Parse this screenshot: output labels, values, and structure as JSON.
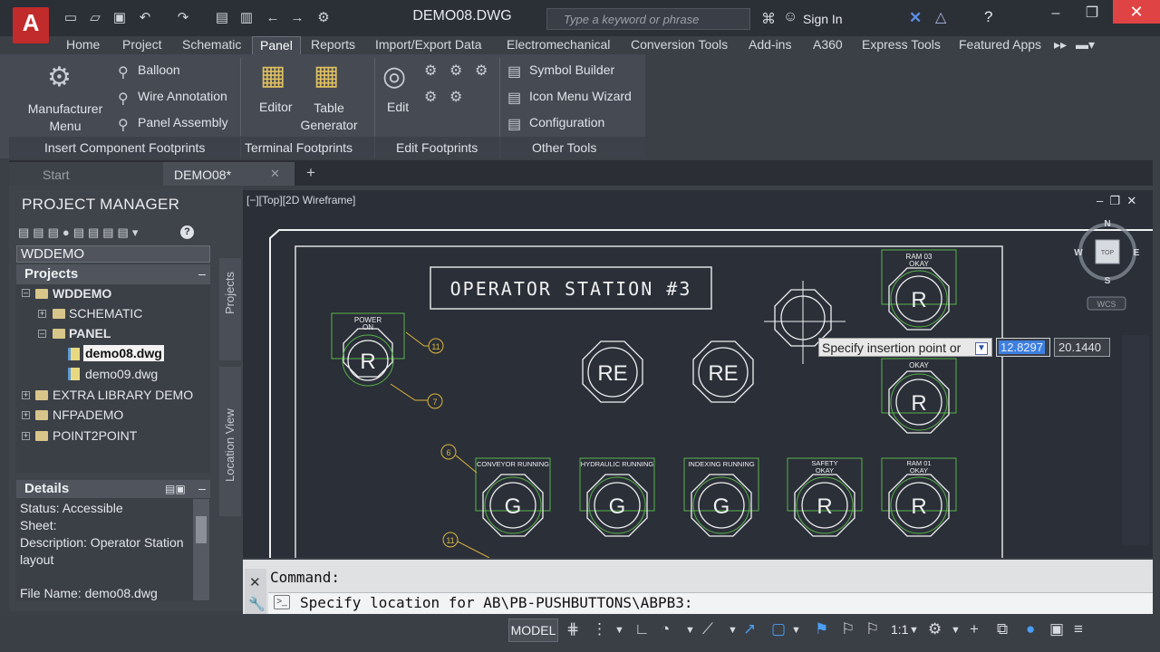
{
  "app": {
    "logo_letter": "A",
    "doc_title": "DEMO08.DWG"
  },
  "search": {
    "placeholder": "Type a keyword or phrase"
  },
  "account": {
    "signin": "Sign In"
  },
  "ribbon_tabs": [
    "Home",
    "Project",
    "Schematic",
    "Panel",
    "Reports",
    "Import/Export Data",
    "Electromechanical",
    "Conversion Tools",
    "Add-ins",
    "A360",
    "Express Tools",
    "Featured Apps"
  ],
  "ribbon": {
    "manufacturer_menu": "Manufacturer Menu",
    "balloon": "Balloon",
    "wire_annotation": "Wire Annotation",
    "panel_assembly": "Panel Assembly",
    "editor": "Editor",
    "table_generator": "Table Generator",
    "edit": "Edit",
    "symbol_builder": "Symbol Builder",
    "icon_menu_wizard": "Icon Menu  Wizard",
    "configuration": "Configuration",
    "panel_insert": "Insert Component Footprints",
    "panel_terminal": "Terminal Footprints",
    "panel_edit": "Edit Footprints",
    "panel_other": "Other Tools"
  },
  "doc_tabs": {
    "start": "Start",
    "active": "DEMO08*"
  },
  "project_manager": {
    "title": "PROJECT MANAGER",
    "project_select": "WDDEMO",
    "projects_header": "Projects",
    "tree": [
      {
        "label": "WDDEMO"
      },
      {
        "label": "SCHEMATIC"
      },
      {
        "label": "PANEL"
      },
      {
        "label": "demo08.dwg"
      },
      {
        "label": "demo09.dwg"
      },
      {
        "label": "EXTRA LIBRARY DEMO"
      },
      {
        "label": "NFPADEMO"
      },
      {
        "label": "POINT2POINT"
      }
    ],
    "details_header": "Details",
    "details": {
      "status": "Status: Accessible",
      "sheet": "Sheet:",
      "description": "Description: Operator Station",
      "description_cont": "layout",
      "file_name": "File Name: demo08.dwg"
    },
    "side_tabs": {
      "projects": "Projects",
      "location": "Location View"
    }
  },
  "viewport": {
    "label": "[−][Top][2D Wireframe]",
    "compass": {
      "n": "N",
      "s": "S",
      "e": "E",
      "w": "W",
      "top": "TOP",
      "wcs": "WCS"
    }
  },
  "drawing": {
    "title": "OPERATOR STATION #3",
    "buttons": [
      {
        "letter": "R",
        "caption": "POWER ON"
      },
      {
        "letter": "RE",
        "caption": ""
      },
      {
        "letter": "RE",
        "caption": ""
      },
      {
        "letter": "R",
        "caption": "RAM 03 OKAY"
      },
      {
        "letter": "R",
        "caption": "OKAY"
      },
      {
        "letter": "G",
        "caption": "CONVEYOR RUNNING"
      },
      {
        "letter": "G",
        "caption": "HYDRAULIC RUNNING"
      },
      {
        "letter": "G",
        "caption": "INDEXING RUNNING"
      },
      {
        "letter": "R",
        "caption": "SAFETY OKAY"
      },
      {
        "letter": "R",
        "caption": "RAM 01 OKAY"
      }
    ],
    "balloons": [
      "11",
      "7",
      "6",
      "11"
    ],
    "tooltip": "Specify insertion point or",
    "input_x": "12.8297",
    "input_y": "20.1440"
  },
  "command": {
    "label": "Command:",
    "line": "Specify location for AB\\PB-PUSHBUTTONS\\ABPB3:"
  },
  "status": {
    "model": "MODEL",
    "scale": "1:1"
  }
}
